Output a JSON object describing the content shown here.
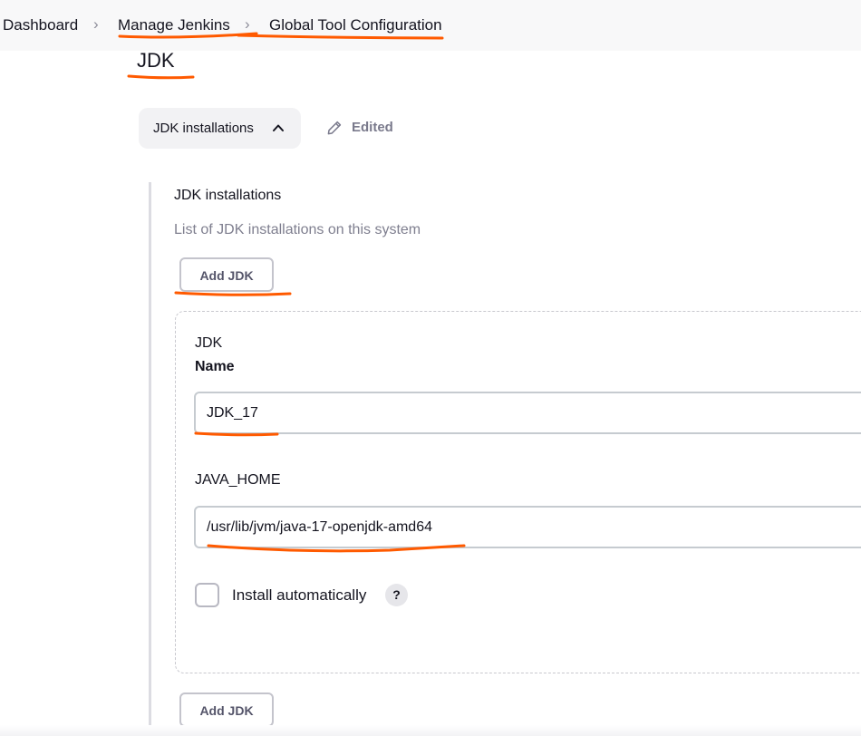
{
  "breadcrumb": {
    "items": [
      "Dashboard",
      "Manage Jenkins",
      "Global Tool Configuration"
    ]
  },
  "page": {
    "title": "JDK"
  },
  "section": {
    "toggle_label": "JDK installations",
    "status_label": "Edited"
  },
  "jdk_installations": {
    "label": "JDK installations",
    "description": "List of JDK installations on this system",
    "add_button_label": "Add JDK",
    "entries": [
      {
        "header": "JDK",
        "name_label": "Name",
        "name_value": "JDK_17",
        "java_home_label": "JAVA_HOME",
        "java_home_value": "/usr/lib/jvm/java-17-openjdk-amd64",
        "install_auto_label": "Install automatically",
        "install_auto_checked": false,
        "help_glyph": "?"
      }
    ]
  },
  "icons": {
    "breadcrumb_separator": "chevron-right-icon",
    "toggle": "chevron-up-icon",
    "status": "pencil-icon",
    "help": "help-icon"
  },
  "colors": {
    "annotation_underline": "#ff5a00",
    "breadcrumb_bg": "#f8f8f9",
    "toggle_bg": "#f2f2f4"
  }
}
